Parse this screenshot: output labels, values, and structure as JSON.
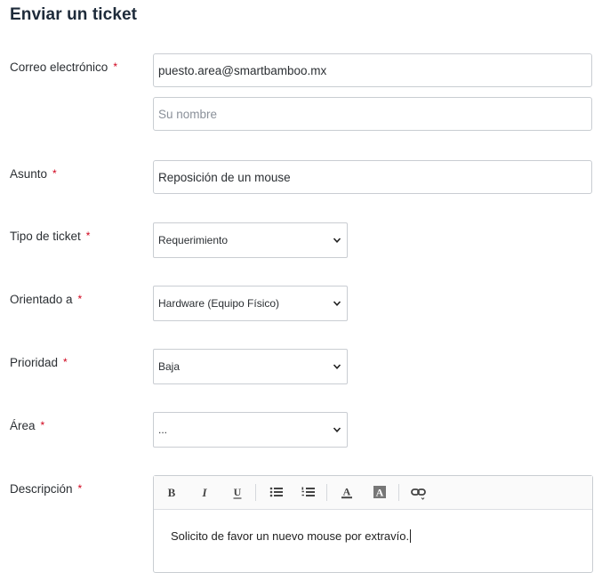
{
  "page": {
    "title": "Enviar un ticket"
  },
  "required_marker": "*",
  "form": {
    "email": {
      "label": "Correo electrónico",
      "value": "puesto.area@smartbamboo.mx"
    },
    "name": {
      "placeholder": "Su nombre",
      "value": ""
    },
    "subject": {
      "label": "Asunto",
      "value": "Reposición de un mouse"
    },
    "ticket_type": {
      "label": "Tipo de ticket",
      "selected": "Requerimiento"
    },
    "oriented_to": {
      "label": "Orientado a",
      "selected": "Hardware (Equipo Físico)"
    },
    "priority": {
      "label": "Prioridad",
      "selected": "Baja"
    },
    "area": {
      "label": "Área",
      "selected": "..."
    },
    "description": {
      "label": "Descripción",
      "toolbar": [
        "bold-icon",
        "italic-icon",
        "underline-icon",
        "bulleted-list-icon",
        "numbered-list-icon",
        "text-color-icon",
        "background-color-icon",
        "link-icon"
      ],
      "content": "Solicito de favor un nuevo mouse por extravío."
    }
  }
}
